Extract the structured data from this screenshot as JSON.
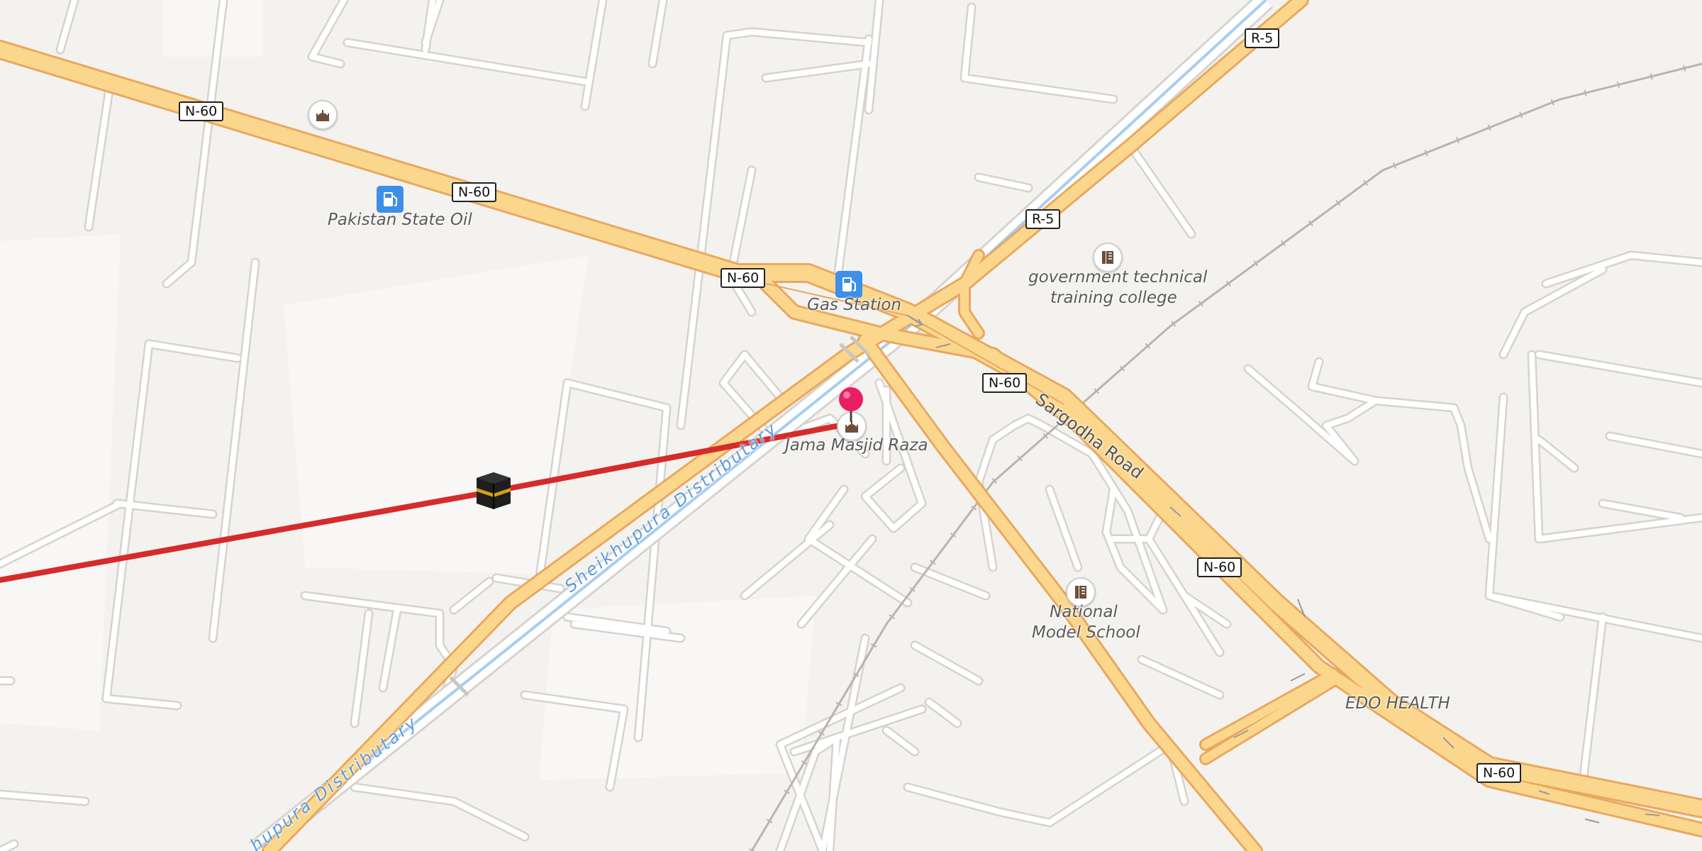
{
  "map": {
    "road_shields": [
      "N-60",
      "N-60",
      "N-60",
      "N-60",
      "N-60",
      "N-60",
      "R-5",
      "R-5"
    ],
    "road_names": {
      "sargodha": "Sargodha Road",
      "canal_1": "Sheikhupura Distributary",
      "canal_2": "Sheikhupura Distributary",
      "canal_2_visible": "hupura Distributary"
    },
    "places": {
      "pso": "Pakistan State Oil",
      "gas_station": "Gas Station",
      "college_1": "government technical",
      "college_2": "training college",
      "masjid": "Jama Masjid Raza",
      "school_1": "National",
      "school_2": "Model School",
      "edo": "EDO HEALTH"
    },
    "icons": {
      "fuel": "fuel-pump-icon",
      "education": "school-icon",
      "worship": "mosque-icon",
      "pin": "location-pin-icon",
      "kaaba": "kaaba-icon"
    },
    "colors": {
      "background": "#f4f2ef",
      "minor_road": "#ffffff",
      "major_road": "#fbd78e",
      "major_road_casing": "#e9a85f",
      "water": "#a8cdf0",
      "qibla_line": "#d62b2b",
      "pin": "#e91e63",
      "fuel_icon": "#3d8fe8"
    }
  }
}
